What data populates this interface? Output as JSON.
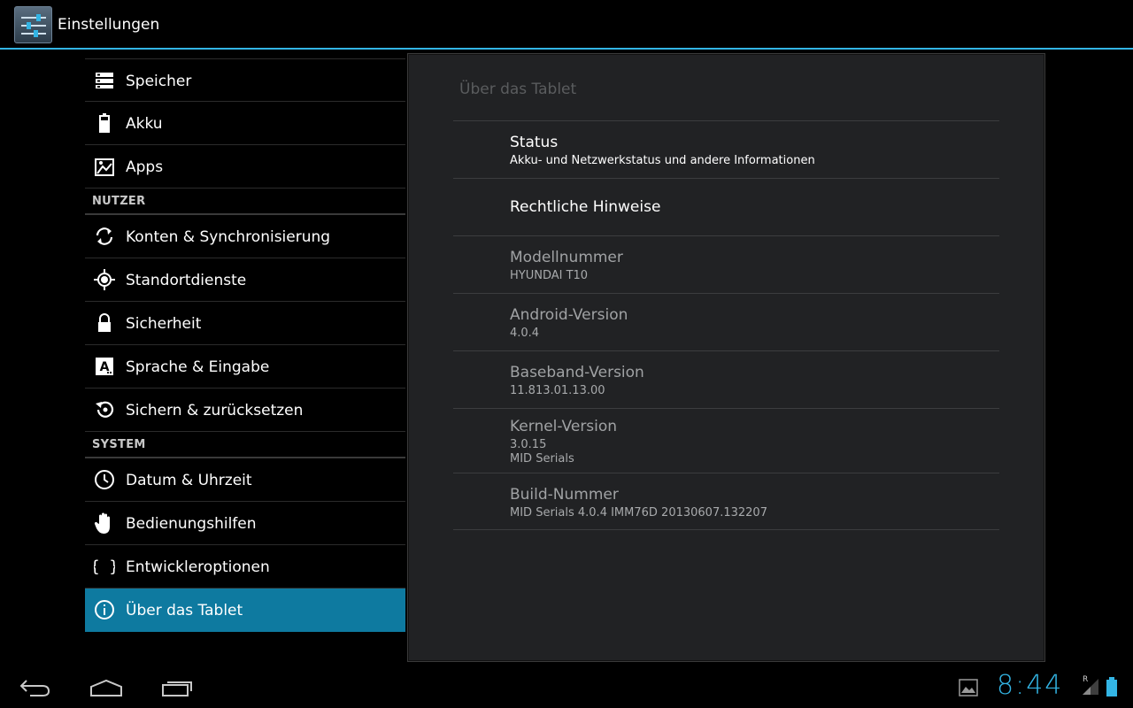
{
  "actionbar": {
    "title": "Einstellungen",
    "icon": "settings-sliders-icon"
  },
  "sidebar": {
    "items": [
      {
        "type": "item",
        "name": "sidebar-item-storage",
        "icon": "storage-icon",
        "label": "Speicher"
      },
      {
        "type": "item",
        "name": "sidebar-item-battery",
        "icon": "battery-icon",
        "label": "Akku"
      },
      {
        "type": "item",
        "name": "sidebar-item-apps",
        "icon": "apps-icon",
        "label": "Apps"
      },
      {
        "type": "category",
        "name": "category-user",
        "label": "NUTZER"
      },
      {
        "type": "item",
        "name": "sidebar-item-accounts-sync",
        "icon": "sync-icon",
        "label": "Konten & Synchronisierung"
      },
      {
        "type": "item",
        "name": "sidebar-item-location",
        "icon": "location-icon",
        "label": "Standortdienste"
      },
      {
        "type": "item",
        "name": "sidebar-item-security",
        "icon": "lock-icon",
        "label": "Sicherheit"
      },
      {
        "type": "item",
        "name": "sidebar-item-language-input",
        "icon": "language-icon",
        "label": "Sprache & Eingabe"
      },
      {
        "type": "item",
        "name": "sidebar-item-backup-reset",
        "icon": "backup-reset-icon",
        "label": "Sichern & zurücksetzen"
      },
      {
        "type": "category",
        "name": "category-system",
        "label": "SYSTEM"
      },
      {
        "type": "item",
        "name": "sidebar-item-date-time",
        "icon": "clock-icon",
        "label": "Datum & Uhrzeit"
      },
      {
        "type": "item",
        "name": "sidebar-item-accessibility",
        "icon": "hand-icon",
        "label": "Bedienungshilfen"
      },
      {
        "type": "item",
        "name": "sidebar-item-developer-options",
        "icon": "braces-icon",
        "label": "Entwickleroptionen"
      },
      {
        "type": "item",
        "name": "sidebar-item-about-tablet",
        "icon": "info-icon",
        "label": "Über das Tablet",
        "selected": true
      }
    ]
  },
  "detail": {
    "title": "Über das Tablet",
    "prefs": [
      {
        "name": "pref-status",
        "title": "Status",
        "summary": [
          "Akku- und Netzwerkstatus und andere Informationen"
        ],
        "enabled": true
      },
      {
        "name": "pref-legal",
        "title": "Rechtliche Hinweise",
        "summary": [],
        "enabled": true
      },
      {
        "name": "pref-model-number",
        "title": "Modellnummer",
        "summary": [
          "HYUNDAI T10"
        ],
        "enabled": false
      },
      {
        "name": "pref-android-version",
        "title": "Android-Version",
        "summary": [
          "4.0.4"
        ],
        "enabled": false
      },
      {
        "name": "pref-baseband-version",
        "title": "Baseband-Version",
        "summary": [
          "11.813.01.13.00"
        ],
        "enabled": false
      },
      {
        "name": "pref-kernel-version",
        "title": "Kernel-Version",
        "summary": [
          "3.0.15",
          "MID Serials"
        ],
        "enabled": false
      },
      {
        "name": "pref-build-number",
        "title": "Build-Nummer",
        "summary": [
          "MID Serials 4.0.4 IMM76D 20130607.132207"
        ],
        "enabled": false
      }
    ]
  },
  "navbar": {
    "buttons": [
      "back-icon",
      "home-icon",
      "recent-apps-icon"
    ],
    "clock": "8:44",
    "status_icons": [
      "gallery-notification-icon",
      "signal-roaming-icon",
      "battery-status-icon"
    ],
    "roaming_indicator": "R"
  },
  "colors": {
    "accent": "#33b5e5",
    "selected": "#0e7aa0"
  }
}
